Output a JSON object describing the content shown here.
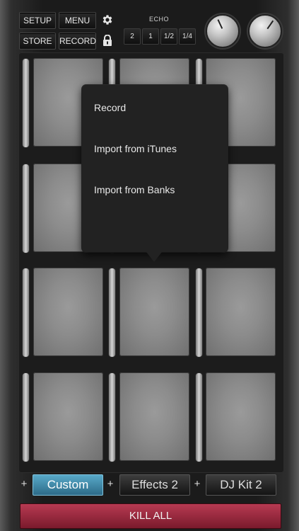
{
  "toolbar": {
    "setup_label": "SETUP",
    "menu_label": "MENU",
    "store_label": "STORE",
    "record_label": "RECORD"
  },
  "echo": {
    "label": "ECHO",
    "options": [
      "2",
      "1",
      "1/2",
      "1/4"
    ]
  },
  "popover": {
    "items": [
      "Record",
      "Import from iTunes",
      "Import from Banks"
    ]
  },
  "banks": {
    "tabs": [
      "Custom",
      "Effects 2",
      "DJ Kit 2"
    ],
    "active": "Custom",
    "add_label": "+"
  },
  "footer": {
    "kill_all_label": "KILL ALL"
  },
  "colors": {
    "active_tab": "#3f8fb0",
    "kill_all": "#9a2a40"
  }
}
